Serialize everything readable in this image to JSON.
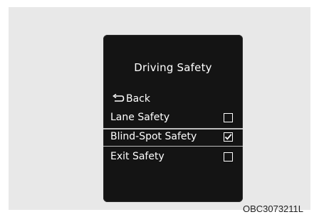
{
  "screen": {
    "title": "Driving Safety",
    "back_label": "Back",
    "items": [
      {
        "label": "Lane Safety",
        "checked": false,
        "selected": false
      },
      {
        "label": "Blind-Spot Safety",
        "checked": true,
        "selected": true
      },
      {
        "label": "Exit Safety",
        "checked": false,
        "selected": false
      }
    ]
  },
  "caption": "OBC3073211L",
  "colors": {
    "screen_background": "#141414",
    "panel_background": "#e8e8e8",
    "text": "#ffffff",
    "selection_line": "#bdbdbd"
  }
}
